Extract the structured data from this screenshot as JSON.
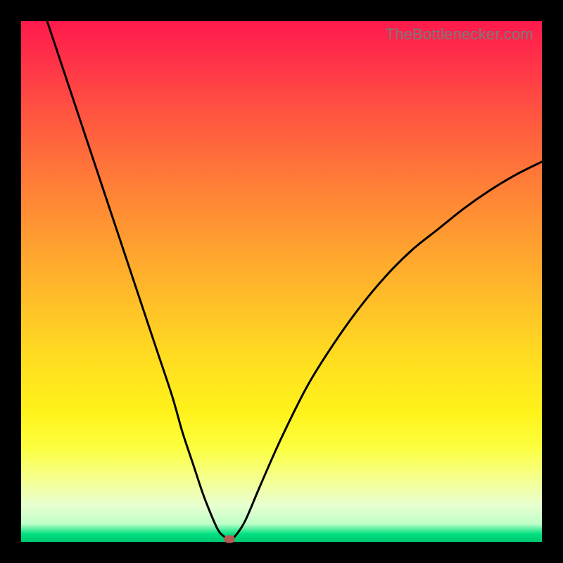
{
  "attribution": "TheBottlenecker.com",
  "chart_data": {
    "type": "line",
    "title": "",
    "xlabel": "",
    "ylabel": "",
    "xlim": [
      0,
      100
    ],
    "ylim": [
      0,
      100
    ],
    "series": [
      {
        "name": "bottleneck-curve",
        "x": [
          5,
          8,
          11,
          14,
          17,
          20,
          23,
          26,
          29,
          31,
          33,
          35,
          37,
          38,
          39,
          40,
          41,
          43,
          46,
          50,
          55,
          60,
          65,
          70,
          75,
          80,
          85,
          90,
          95,
          100
        ],
        "y": [
          100,
          91,
          82,
          73,
          64,
          55,
          46,
          37,
          28,
          21,
          15,
          9,
          4,
          2,
          1,
          0.5,
          1,
          4,
          11,
          20,
          30,
          38,
          45,
          51,
          56,
          60,
          64,
          67.5,
          70.5,
          73
        ]
      }
    ],
    "marker": {
      "x": 40,
      "y": 0.5
    },
    "colors": {
      "curve": "#000000",
      "marker": "#b65a52",
      "gradient_top": "#ff1a4d",
      "gradient_mid": "#ffe020",
      "gradient_bottom": "#00c870"
    }
  }
}
